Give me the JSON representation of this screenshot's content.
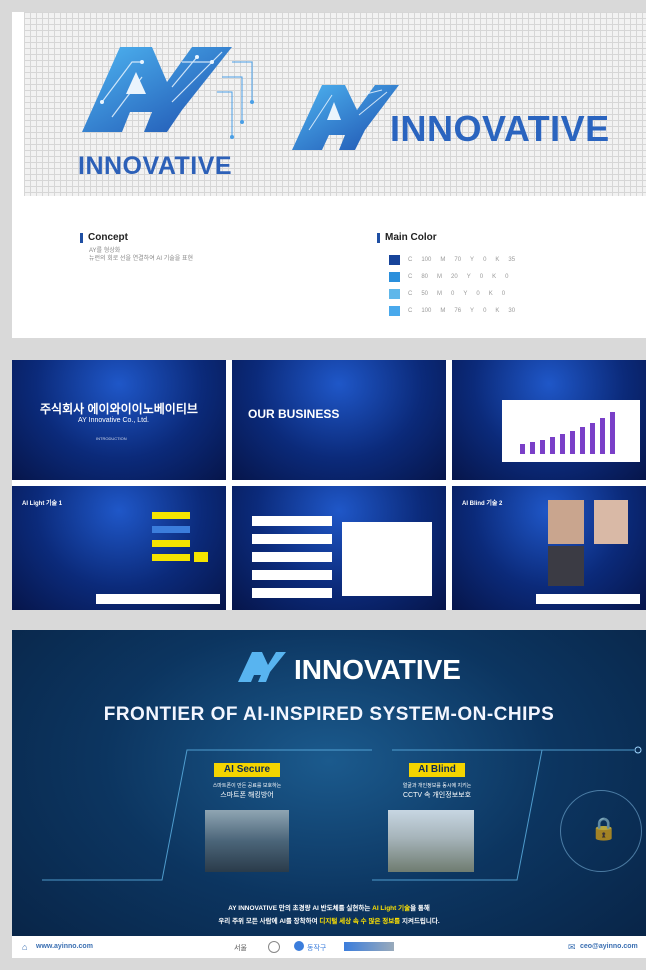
{
  "panel1": {
    "logo_word_left": "INNOVATIVE",
    "logo_word_right": "INNOVATIVE",
    "concept": {
      "title": "Concept",
      "line1": "AY를 형상화",
      "line2": "뉴런의 회로 선을 연결하여 AI 기술을 표현"
    },
    "main_color": {
      "title": "Main Color",
      "rows": [
        {
          "hex": "#17449a",
          "values": [
            "C",
            "100",
            "M",
            "70",
            "Y",
            "0",
            "K",
            "35"
          ]
        },
        {
          "hex": "#2a8fdc",
          "values": [
            "C",
            "80",
            "M",
            "20",
            "Y",
            "0",
            "K",
            "0"
          ]
        },
        {
          "hex": "#5fb7ea",
          "values": [
            "C",
            "50",
            "M",
            "0",
            "Y",
            "0",
            "K",
            "0"
          ]
        },
        {
          "hex": "#49a9ec",
          "values": [
            "C",
            "100",
            "M",
            "76",
            "Y",
            "0",
            "K",
            "30"
          ]
        }
      ]
    }
  },
  "panel2": {
    "slide1": {
      "title": "주식회사 에이와이이노베이티브",
      "subtitle": "AY Innovative Co., Ltd.",
      "small": "INTRODUCTION"
    },
    "slide2": {
      "title": "OUR BUSINESS"
    },
    "slide4": {
      "title": "AI Light 기술 1"
    },
    "slide6": {
      "title": "AI Blind 기술 2"
    }
  },
  "panel3": {
    "logo_word": "INNOVATIVE",
    "headline": "FRONTIER OF AI-INSPIRED SYSTEM-ON-CHIPS",
    "left": {
      "tag": "AI Secure",
      "line1": "스마트폰이 만든 공료를 보호하는",
      "line2": "스마트폰 해킹방어"
    },
    "right": {
      "tag": "AI Blind",
      "line1": "얼굴과 개인정보를 동시에 지키는",
      "line2": "CCTV 속 개인정보보호"
    },
    "bottom_line1_pre": "AY INNOVATIVE 만의 초경량 AI 반도체를 실현하는",
    "bottom_line1_hl": "AI Light 기술",
    "bottom_line1_post": "을 통해",
    "bottom_line2_pre": "우리 주위 모든 사람에 AI를 장착하여",
    "bottom_line2_hl": "디지털 세상 속 수 많은 정보를",
    "bottom_line2_post": "지켜드립니다.",
    "footer": {
      "website": "www.ayinno.com",
      "partner1": "서울",
      "partner2": "동작구",
      "email": "ceo@ayinno.com"
    }
  }
}
